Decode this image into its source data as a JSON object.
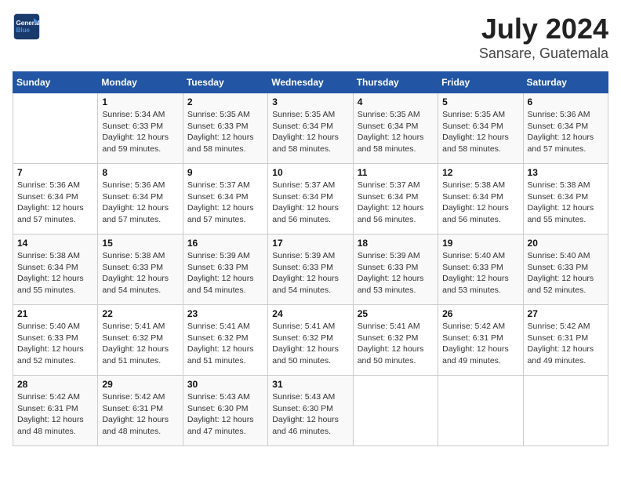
{
  "logo": {
    "line1": "General",
    "line2": "Blue"
  },
  "title": "July 2024",
  "subtitle": "Sansare, Guatemala",
  "days_header": [
    "Sunday",
    "Monday",
    "Tuesday",
    "Wednesday",
    "Thursday",
    "Friday",
    "Saturday"
  ],
  "weeks": [
    [
      {
        "day": "",
        "info": ""
      },
      {
        "day": "1",
        "info": "Sunrise: 5:34 AM\nSunset: 6:33 PM\nDaylight: 12 hours\nand 59 minutes."
      },
      {
        "day": "2",
        "info": "Sunrise: 5:35 AM\nSunset: 6:33 PM\nDaylight: 12 hours\nand 58 minutes."
      },
      {
        "day": "3",
        "info": "Sunrise: 5:35 AM\nSunset: 6:34 PM\nDaylight: 12 hours\nand 58 minutes."
      },
      {
        "day": "4",
        "info": "Sunrise: 5:35 AM\nSunset: 6:34 PM\nDaylight: 12 hours\nand 58 minutes."
      },
      {
        "day": "5",
        "info": "Sunrise: 5:35 AM\nSunset: 6:34 PM\nDaylight: 12 hours\nand 58 minutes."
      },
      {
        "day": "6",
        "info": "Sunrise: 5:36 AM\nSunset: 6:34 PM\nDaylight: 12 hours\nand 57 minutes."
      }
    ],
    [
      {
        "day": "7",
        "info": "Sunrise: 5:36 AM\nSunset: 6:34 PM\nDaylight: 12 hours\nand 57 minutes."
      },
      {
        "day": "8",
        "info": "Sunrise: 5:36 AM\nSunset: 6:34 PM\nDaylight: 12 hours\nand 57 minutes."
      },
      {
        "day": "9",
        "info": "Sunrise: 5:37 AM\nSunset: 6:34 PM\nDaylight: 12 hours\nand 57 minutes."
      },
      {
        "day": "10",
        "info": "Sunrise: 5:37 AM\nSunset: 6:34 PM\nDaylight: 12 hours\nand 56 minutes."
      },
      {
        "day": "11",
        "info": "Sunrise: 5:37 AM\nSunset: 6:34 PM\nDaylight: 12 hours\nand 56 minutes."
      },
      {
        "day": "12",
        "info": "Sunrise: 5:38 AM\nSunset: 6:34 PM\nDaylight: 12 hours\nand 56 minutes."
      },
      {
        "day": "13",
        "info": "Sunrise: 5:38 AM\nSunset: 6:34 PM\nDaylight: 12 hours\nand 55 minutes."
      }
    ],
    [
      {
        "day": "14",
        "info": "Sunrise: 5:38 AM\nSunset: 6:34 PM\nDaylight: 12 hours\nand 55 minutes."
      },
      {
        "day": "15",
        "info": "Sunrise: 5:38 AM\nSunset: 6:33 PM\nDaylight: 12 hours\nand 54 minutes."
      },
      {
        "day": "16",
        "info": "Sunrise: 5:39 AM\nSunset: 6:33 PM\nDaylight: 12 hours\nand 54 minutes."
      },
      {
        "day": "17",
        "info": "Sunrise: 5:39 AM\nSunset: 6:33 PM\nDaylight: 12 hours\nand 54 minutes."
      },
      {
        "day": "18",
        "info": "Sunrise: 5:39 AM\nSunset: 6:33 PM\nDaylight: 12 hours\nand 53 minutes."
      },
      {
        "day": "19",
        "info": "Sunrise: 5:40 AM\nSunset: 6:33 PM\nDaylight: 12 hours\nand 53 minutes."
      },
      {
        "day": "20",
        "info": "Sunrise: 5:40 AM\nSunset: 6:33 PM\nDaylight: 12 hours\nand 52 minutes."
      }
    ],
    [
      {
        "day": "21",
        "info": "Sunrise: 5:40 AM\nSunset: 6:33 PM\nDaylight: 12 hours\nand 52 minutes."
      },
      {
        "day": "22",
        "info": "Sunrise: 5:41 AM\nSunset: 6:32 PM\nDaylight: 12 hours\nand 51 minutes."
      },
      {
        "day": "23",
        "info": "Sunrise: 5:41 AM\nSunset: 6:32 PM\nDaylight: 12 hours\nand 51 minutes."
      },
      {
        "day": "24",
        "info": "Sunrise: 5:41 AM\nSunset: 6:32 PM\nDaylight: 12 hours\nand 50 minutes."
      },
      {
        "day": "25",
        "info": "Sunrise: 5:41 AM\nSunset: 6:32 PM\nDaylight: 12 hours\nand 50 minutes."
      },
      {
        "day": "26",
        "info": "Sunrise: 5:42 AM\nSunset: 6:31 PM\nDaylight: 12 hours\nand 49 minutes."
      },
      {
        "day": "27",
        "info": "Sunrise: 5:42 AM\nSunset: 6:31 PM\nDaylight: 12 hours\nand 49 minutes."
      }
    ],
    [
      {
        "day": "28",
        "info": "Sunrise: 5:42 AM\nSunset: 6:31 PM\nDaylight: 12 hours\nand 48 minutes."
      },
      {
        "day": "29",
        "info": "Sunrise: 5:42 AM\nSunset: 6:31 PM\nDaylight: 12 hours\nand 48 minutes."
      },
      {
        "day": "30",
        "info": "Sunrise: 5:43 AM\nSunset: 6:30 PM\nDaylight: 12 hours\nand 47 minutes."
      },
      {
        "day": "31",
        "info": "Sunrise: 5:43 AM\nSunset: 6:30 PM\nDaylight: 12 hours\nand 46 minutes."
      },
      {
        "day": "",
        "info": ""
      },
      {
        "day": "",
        "info": ""
      },
      {
        "day": "",
        "info": ""
      }
    ]
  ]
}
